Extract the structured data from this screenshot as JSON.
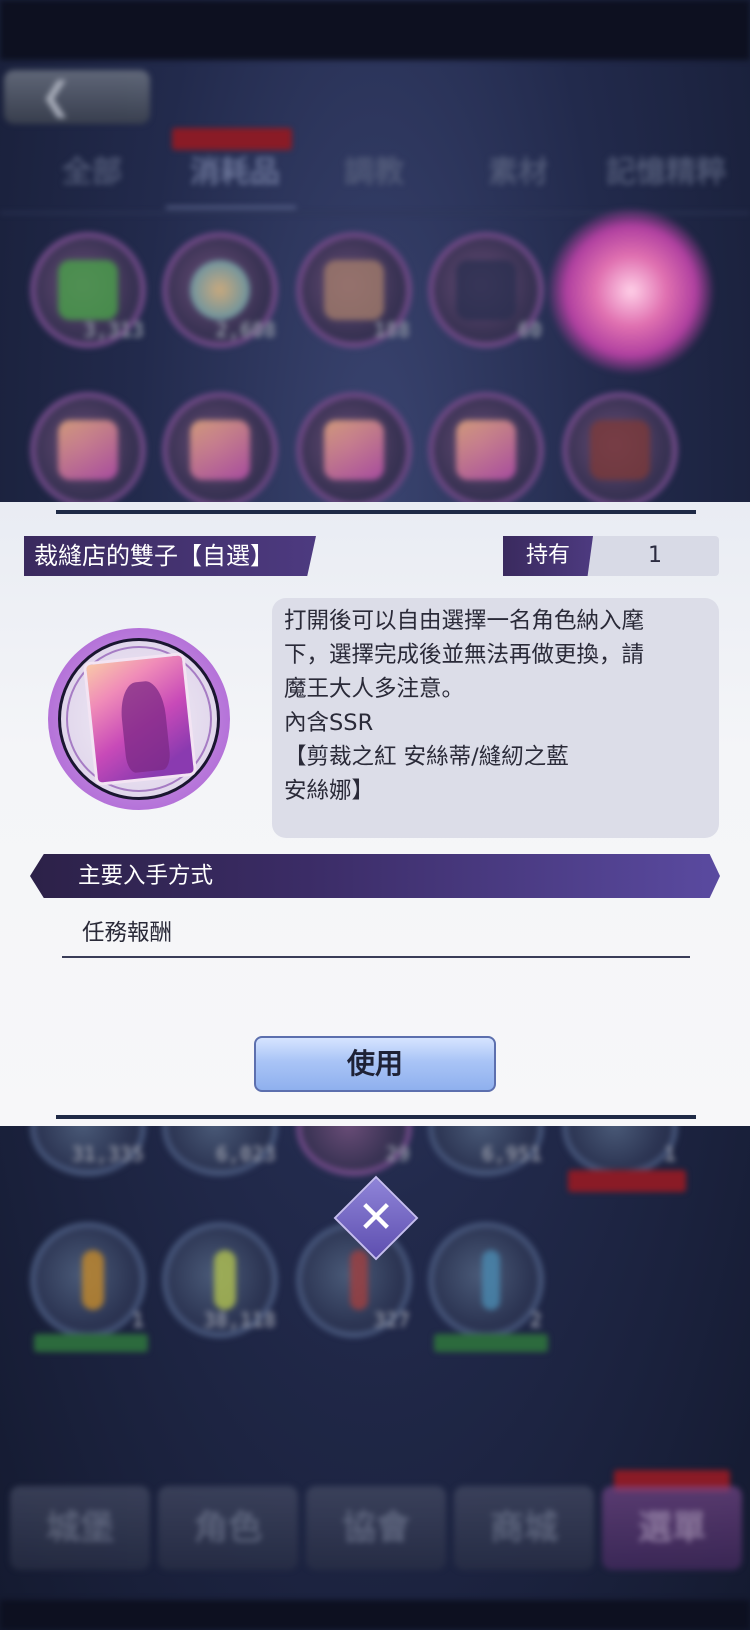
{
  "background": {
    "tabs": [
      {
        "label": "全部"
      },
      {
        "label": "消耗品"
      },
      {
        "label": "調教"
      },
      {
        "label": "素材"
      },
      {
        "label": "記憶精粹"
      }
    ],
    "active_tab_index": 1,
    "grid_counts": [
      "3,313",
      "2,608",
      "188",
      "60"
    ],
    "lower_counts": [
      "31,335",
      "6,023",
      "29",
      "6,951",
      "1"
    ],
    "row3_counts": [
      "1",
      "38,118",
      "327",
      "2"
    ],
    "bottom_nav": [
      {
        "label": "城堡"
      },
      {
        "label": "角色"
      },
      {
        "label": "協會"
      },
      {
        "label": "商城"
      },
      {
        "label": "選單"
      }
    ]
  },
  "modal": {
    "item_title": "裁縫店的雙子【自選】",
    "own_label": "持有",
    "own_value": "1",
    "description": "打開後可以自由選擇一名角色納入麾\n下，選擇完成後並無法再做更換，請\n魔王大人多注意。\n內含SSR\n【剪裁之紅 安絲蒂/縫紉之藍\n安絲娜】",
    "source_section_title": "主要入手方式",
    "source_text": "任務報酬",
    "use_button_label": "使用"
  },
  "close_icon": "close-x-icon",
  "colors": {
    "accent_purple": "#3a2a5e",
    "button_blue": "#a9c4f6"
  }
}
